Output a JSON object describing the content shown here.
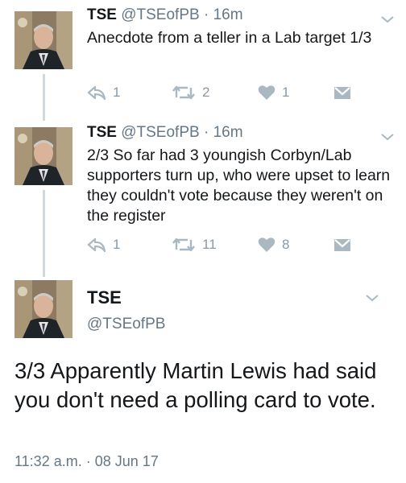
{
  "tweets": [
    {
      "name": "TSE",
      "handle": "@TSEofPB",
      "separator": "·",
      "time": "16m",
      "text": "Anecdote from a teller in a Lab target 1/3",
      "replies": "1",
      "retweets": "2",
      "likes": "1"
    },
    {
      "name": "TSE",
      "handle": "@TSEofPB",
      "separator": "·",
      "time": "16m",
      "text": "2/3 So far had 3 youngish Corbyn/Lab supporters turn up, who were upset to learn they couldn't vote because they weren't on the register",
      "replies": "1",
      "retweets": "11",
      "likes": "8"
    }
  ],
  "main_tweet": {
    "name": "TSE",
    "handle": "@TSEofPB",
    "text": "3/3 Apparently Martin Lewis had said you don't need a polling card to vote.",
    "timestamp": "11:32 a.m. · 08 Jun 17"
  },
  "icons": {
    "reply": "reply-icon",
    "retweet": "retweet-icon",
    "like": "heart-icon",
    "dm": "direct-message-icon",
    "menu": "chevron-down-icon"
  },
  "colors": {
    "icon_gray": "#aab8c2",
    "text": "#14171a",
    "secondary": "#657786",
    "thread_line": "#cfd9de"
  }
}
